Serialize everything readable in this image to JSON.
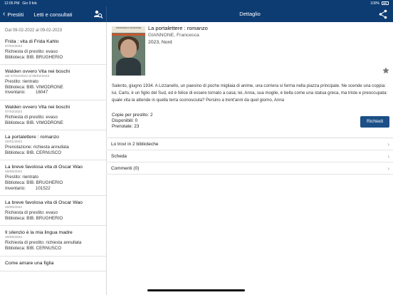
{
  "status_bar": {
    "time": "12:05 PM",
    "date": "Gio 9 feb",
    "battery": "100%"
  },
  "nav": {
    "back_label": "Prestiti",
    "left_title": "Letti e consultati",
    "right_title": "Dettaglio",
    "search_icon": "search-person-icon",
    "share_icon": "share-icon"
  },
  "list": {
    "date_range": "Dal 09-02-2022 al 09-02-2023",
    "items": [
      {
        "title": "Frida : vita di Frida Kahlo",
        "dates": "07/02/2023",
        "lines": [
          "Richiesta di prestito: evaso",
          "Biblioteca: BIB. BRUGHERIO"
        ]
      },
      {
        "title": "Walden ovvero Vita nei boschi",
        "dates": "dal 07/02/2023 al 08/02/2023",
        "lines": [
          "Prestito: rientrato",
          "Biblioteca: BIB. VIMODRONE"
        ],
        "inv_label": "Inventario:",
        "inv_value": "16047"
      },
      {
        "title": "Walden ovvero Vita nei boschi",
        "dates": "07/02/2023",
        "lines": [
          "Richiesta di prestito: evaso",
          "Biblioteca: BIB. VIMODRONE"
        ]
      },
      {
        "title": "La portalettere : romanzo",
        "dates": "02/01/2023",
        "lines": [
          "Prenotazione: richiesta annullata",
          "Biblioteca: BIB. CERNUSCO"
        ]
      },
      {
        "title": "La breve favolosa vita di Oscar Wao",
        "dates": "20/06/2022",
        "lines": [
          "Prestito: rientrato",
          "Biblioteca: BIB. BRUGHERIO"
        ],
        "inv_label": "Inventario:",
        "inv_value": "101522"
      },
      {
        "title": "La breve favolosa vita di Oscar Wao",
        "dates": "20/06/2022",
        "lines": [
          "Richiesta di prestito: evaso",
          "Biblioteca: BIB. BRUGHERIO"
        ]
      },
      {
        "title": "Il silenzio è la mia lingua madre",
        "dates": "20/06/2022",
        "lines": [
          "Richiesta di prestito: richiesta annullata",
          "Biblioteca: BIB. CERNUSCO"
        ]
      },
      {
        "title": "Come amare una figlia",
        "dates": "",
        "lines": []
      }
    ]
  },
  "detail": {
    "cover_text": "FRANCESCA GIANNONE",
    "cover_title": "LA PORTALETTERE",
    "title": "La portalettere : romanzo",
    "author": "GIANNONE, Francesca",
    "publication": "2023, Nord",
    "summary": "Salento, giugno 1934. A Lizzanello, un paesino di poche migliaia di anime, una corriera si ferma nella piazza principale. Ne scende una coppia: lui, Carlo, è un figlio del Sud, ed è felice di essere tornato a casa; lei, Anna, sua moglie, è bella come una statua greca, ma triste e preoccupata: quale vita la attende in quella terra sconosciuta? Persino a trent'anni da quel giorno, Anna",
    "copies_per_loan": "Copie per prestito: 2",
    "available": "Disponibili: 0",
    "reserved": "Prenotate: 23",
    "request_label": "Richiedi",
    "sections": [
      "Lo trovi in 2 biblioteche",
      "Scheda",
      "Commenti (0)"
    ],
    "accent_color": "#1c4f87"
  }
}
